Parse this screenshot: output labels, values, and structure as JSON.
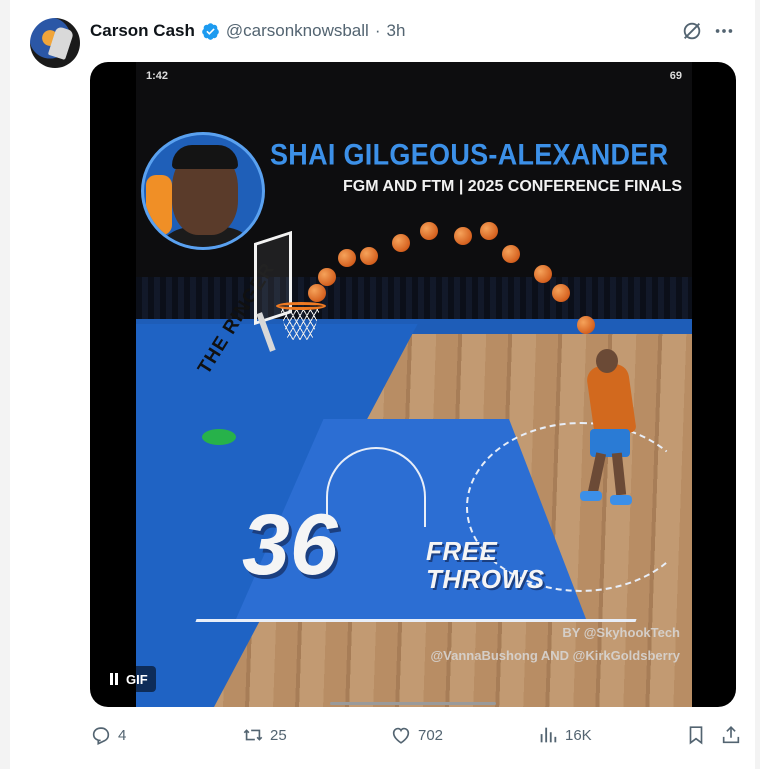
{
  "post": {
    "author_name": "Carson Cash",
    "handle": "@carsonknowsball",
    "separator": "·",
    "time": "3h",
    "verified": true,
    "accent_color": "#1d9bf0"
  },
  "media": {
    "status_time": "1:42",
    "battery": "69",
    "headline_name": "SHAI GILGEOUS-ALEXANDER",
    "headline_subtitle": "FGM AND FTM | 2025 CONFERENCE FINALS",
    "stat_number": "36",
    "stat_word_1": "FREE",
    "stat_word_2": "THROWS",
    "court_text": "THE RINGER",
    "credit_line_1": "BY @SkyhookTech",
    "credit_line_2": "@VannaBushong AND @KirkGoldsberry",
    "gif_label": "GIF",
    "pause_label": "pause-icon"
  },
  "actions": {
    "replies": "4",
    "reposts": "25",
    "likes": "702",
    "views": "16K"
  }
}
